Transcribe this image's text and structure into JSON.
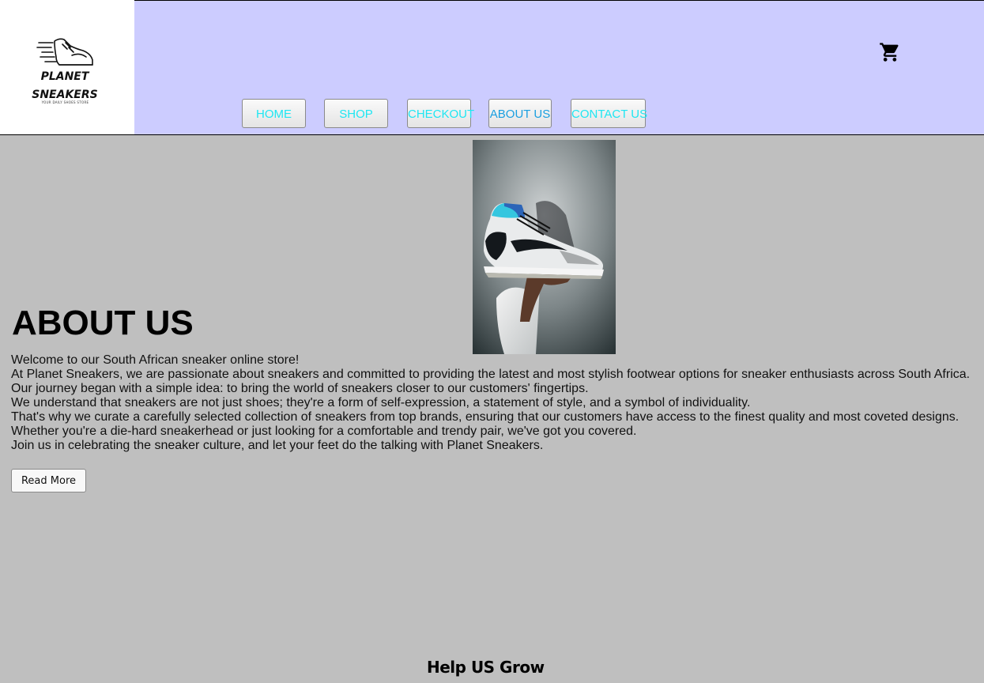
{
  "logo": {
    "line1": "PLANET",
    "line2": "SNEAKERS",
    "tagline": "YOUR DAILY SHOES STORE",
    "icon": "sneaker-logo-icon"
  },
  "header": {
    "cart_icon": "shopping-cart-icon",
    "background_color": "#ccccff"
  },
  "nav": {
    "items": [
      {
        "label": "HOME"
      },
      {
        "label": "SHOP"
      },
      {
        "label": "CHECKOUT"
      },
      {
        "label": "ABOUT US"
      },
      {
        "label": "CONTACT US"
      }
    ],
    "text_color": "#1ee6f2",
    "active_color": "#1a9fe0"
  },
  "hero": {
    "image": "sneaker-in-hand-photo"
  },
  "about": {
    "title": "ABOUT US",
    "paragraphs": [
      "Welcome to our South African sneaker online store!",
      "At Planet Sneakers, we are passionate about sneakers and committed to providing the latest and most stylish footwear options for sneaker enthusiasts across South Africa.",
      "Our journey began with a simple idea: to bring the world of sneakers closer to our customers' fingertips.",
      "We understand that sneakers are not just shoes; they're a form of self-expression, a statement of style, and a symbol of individuality.",
      "That's why we curate a carefully selected collection of sneakers from top brands, ensuring that our customers have access to the finest quality and most coveted designs.",
      "Whether you're a die-hard sneakerhead or just looking for a comfortable and trendy pair, we've got you covered.",
      "Join us in celebrating the sneaker culture, and let your feet do the talking with Planet Sneakers."
    ],
    "read_more_label": "Read More"
  },
  "footer": {
    "help_title": "Help US Grow"
  },
  "colors": {
    "page_background": "#bfbfbf"
  }
}
